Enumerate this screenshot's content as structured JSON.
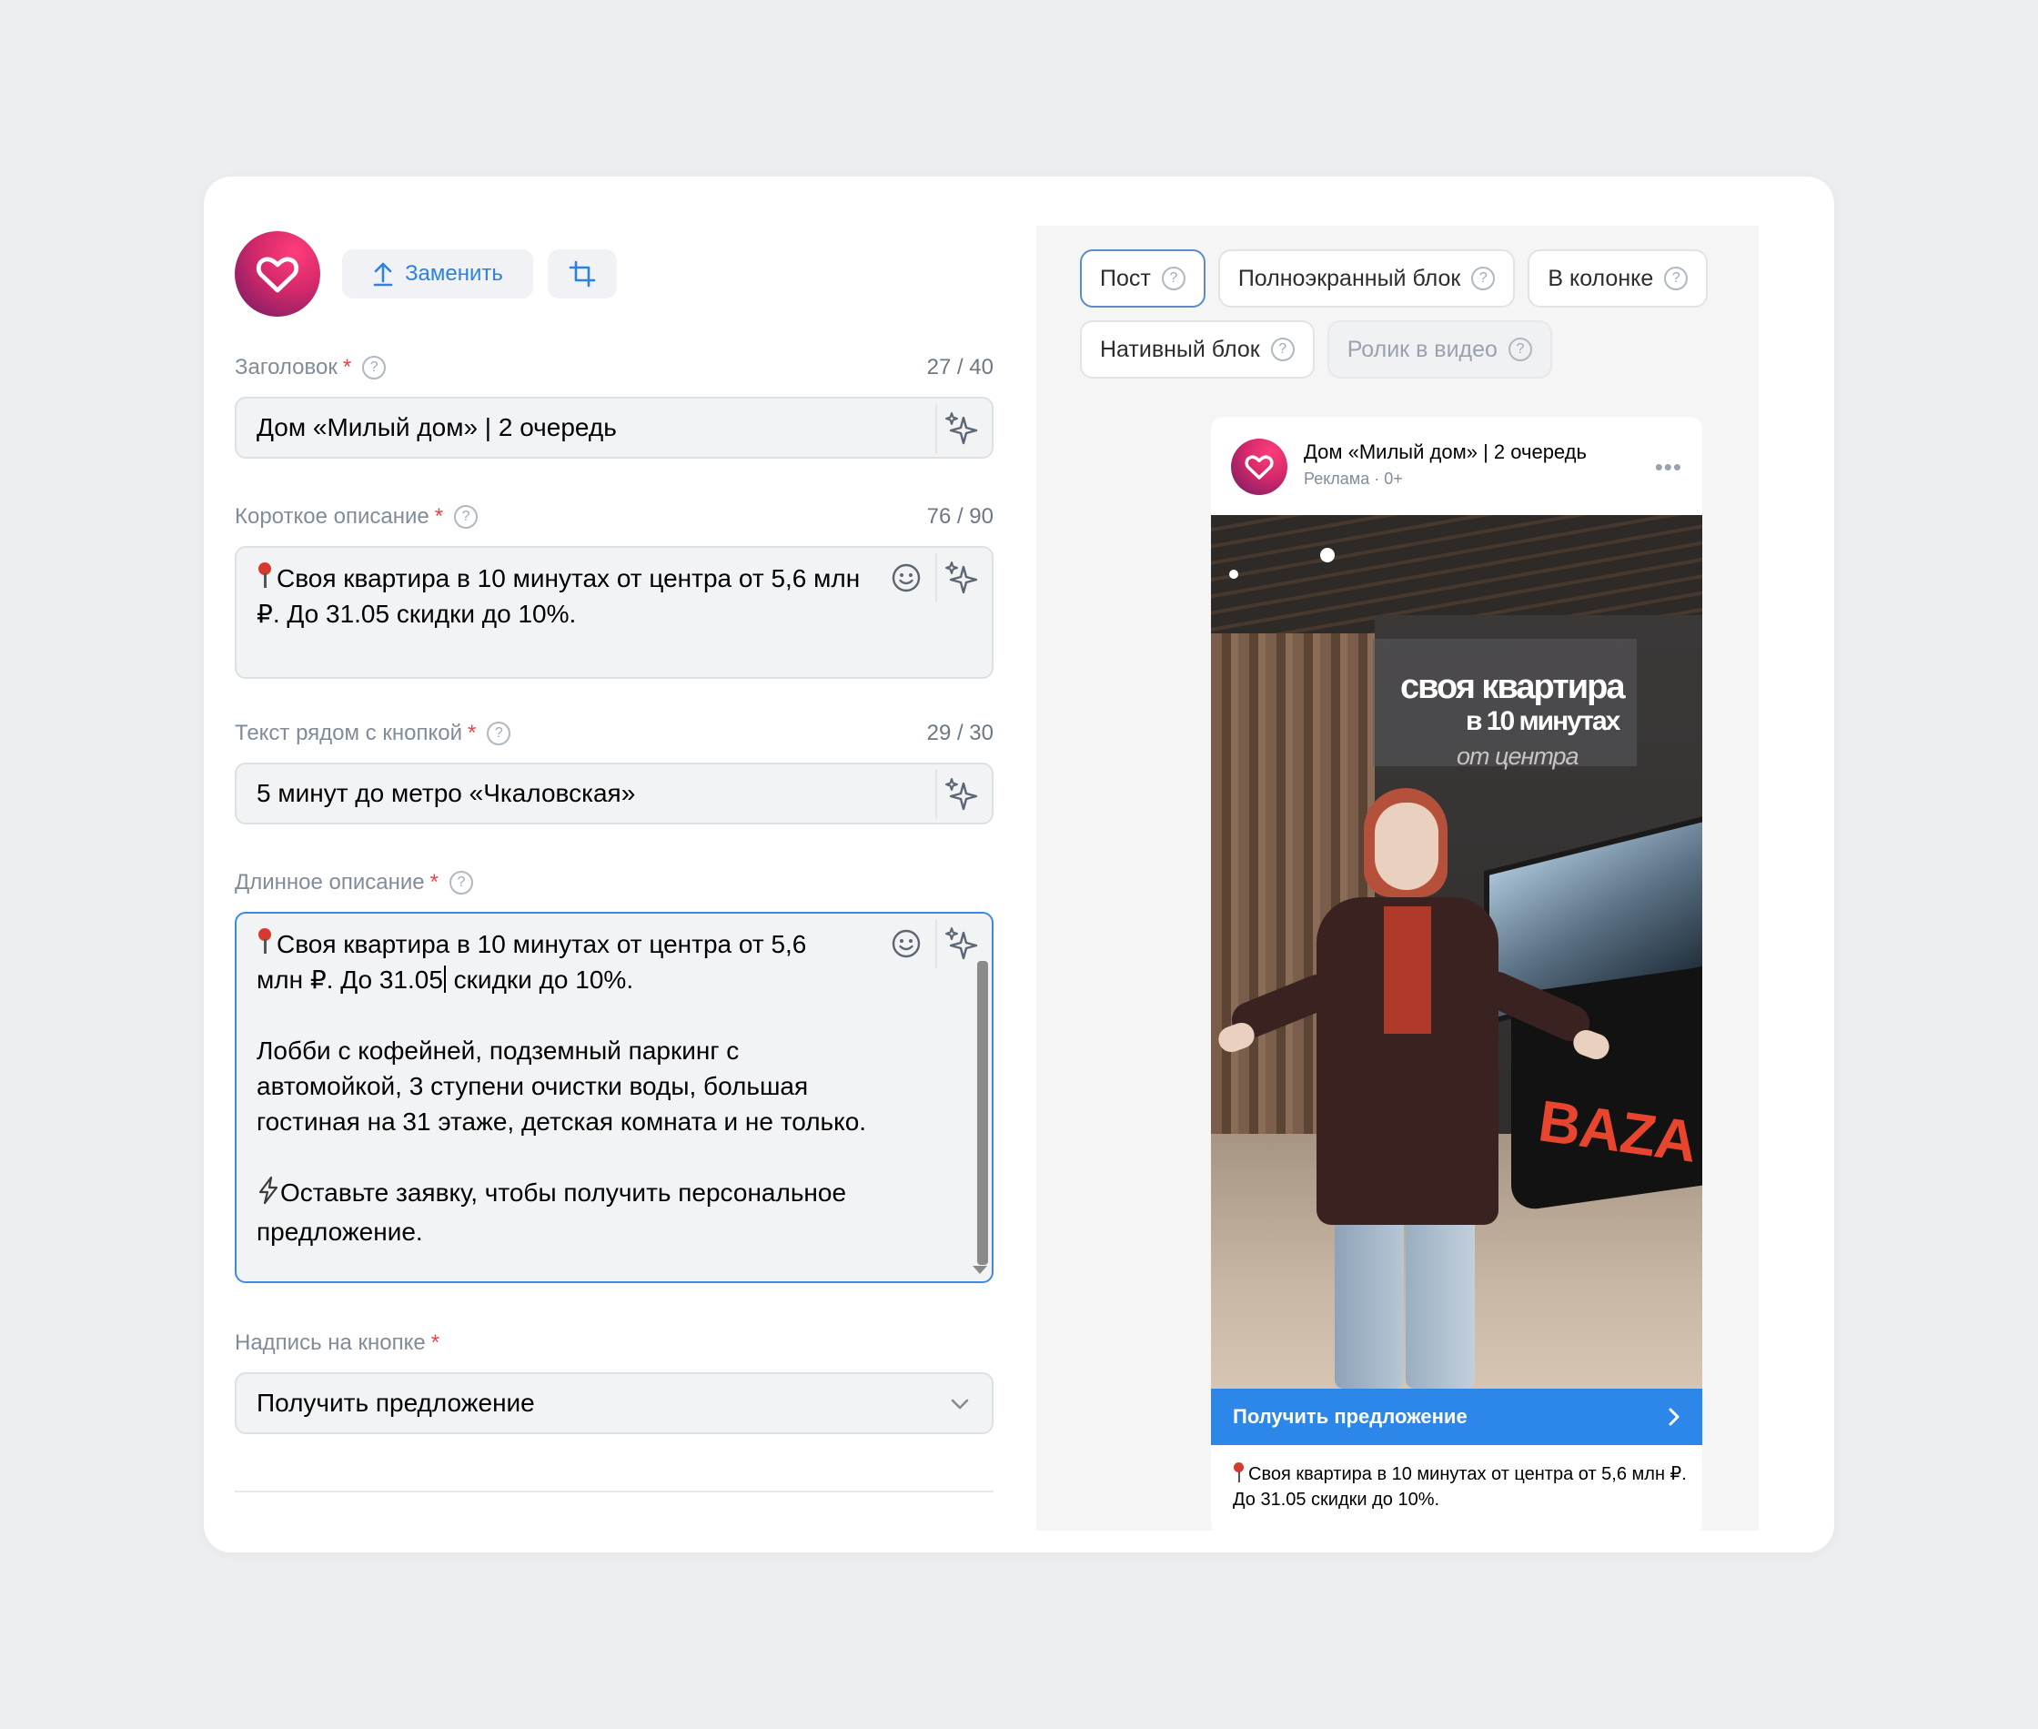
{
  "header": {
    "replace_label": "Заменить"
  },
  "fields": {
    "title": {
      "label": "Заголовок",
      "counter": "27 / 40",
      "value": "Дом «Милый дом» | 2 очередь"
    },
    "short_desc": {
      "label": "Короткое описание",
      "counter": "76 / 90",
      "value": "Своя квартира в 10 минутах от центра от 5,6 млн ₽. До 31.05 скидки до 10%."
    },
    "button_text": {
      "label": "Текст рядом с кнопкой",
      "counter": "29 / 30",
      "value": "5 минут до метро «Чкаловская»"
    },
    "long_desc": {
      "label": "Длинное описание",
      "line1_a": "Своя квартира в 10 минутах от центра от 5,6",
      "line2_a": "млн ₽. До 31.05",
      "line2_b": " скидки до 10%.",
      "para2": "Лобби с кофейней, подземный паркинг с автомойкой, 3 ступени очистки воды, большая гостиная на 31 этаже, детская комната и не только.",
      "para3": "Оставьте заявку, чтобы получить персональное предложение."
    },
    "cta_select": {
      "label": "Надпись на кнопке",
      "value": "Получить предложение"
    }
  },
  "formats": [
    {
      "label": "Пост",
      "state": "active"
    },
    {
      "label": "Полноэкранный блок",
      "state": "normal"
    },
    {
      "label": "В колонке",
      "state": "normal"
    },
    {
      "label": "Нативный блок",
      "state": "normal"
    },
    {
      "label": "Ролик в видео",
      "state": "disabled"
    }
  ],
  "preview": {
    "title": "Дом «Милый дом» | 2 очередь",
    "subtitle": "Реклама · 0+",
    "video_text_1": "своя квартира",
    "video_text_2": "в 10 минутах",
    "video_text_3": "от центра",
    "brand": "BAZA",
    "cta_label": "Получить предложение",
    "description": "Своя квартира в 10 минутах от центра от 5,6 млн ₽. До 31.05 скидки до 10%."
  },
  "colors": {
    "accent": "#2c87e8",
    "required": "#e64646",
    "brand_pink": "#d2286a"
  },
  "icons": {
    "heart": "heart-icon",
    "upload": "upload-icon",
    "crop": "crop-icon",
    "help": "question-icon",
    "sparkle": "sparkle-icon",
    "emoji": "emoji-icon",
    "chevron": "chevron-down-icon",
    "pin": "round-pushpin-icon",
    "lightning": "lightning-icon",
    "more": "more-icon"
  }
}
